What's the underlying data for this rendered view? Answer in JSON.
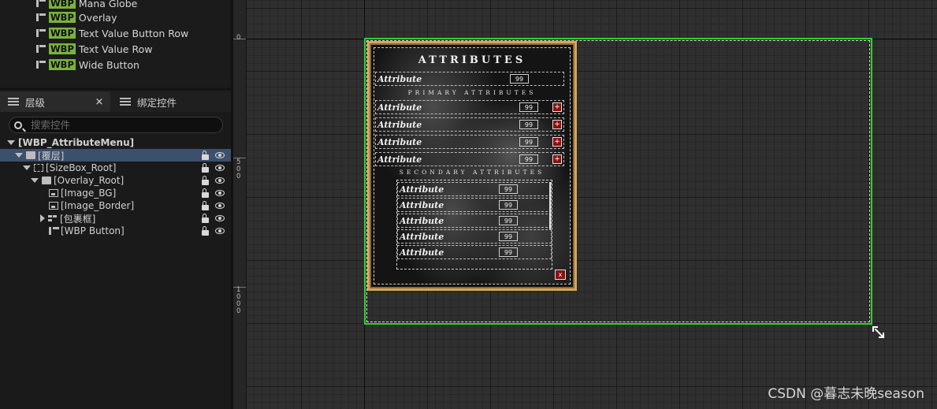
{
  "library": {
    "items": [
      {
        "badge": "WBP",
        "label": "Mana Globe"
      },
      {
        "badge": "WBP",
        "label": "Overlay"
      },
      {
        "badge": "WBP",
        "label": "Text Value Button Row"
      },
      {
        "badge": "WBP",
        "label": "Text Value Row"
      },
      {
        "badge": "WBP",
        "label": "Wide Button"
      }
    ]
  },
  "tabs": {
    "hierarchy": "层级",
    "bind_widgets": "绑定控件",
    "close": "×"
  },
  "search": {
    "placeholder": "搜索控件"
  },
  "tree": {
    "root": "[WBP_AttributeMenu]",
    "nodes": [
      {
        "label": "[覆层]"
      },
      {
        "label": "[SizeBox_Root]"
      },
      {
        "label": "[Overlay_Root]"
      },
      {
        "label": "[Image_BG]"
      },
      {
        "label": "[Image_Border]"
      },
      {
        "label": "[包裹框]"
      },
      {
        "label": "[WBP Button]"
      }
    ]
  },
  "ruler": {
    "ticks": [
      "0",
      "5\n0\n0",
      "1\n0\n0\n0"
    ]
  },
  "widget": {
    "title": "ATTRIBUTES",
    "top_row": {
      "label": "Attribute",
      "value": "99"
    },
    "primary_title": "PRIMARY ATTRIBUTES",
    "primary_rows": [
      {
        "label": "Attribute",
        "value": "99",
        "button": "+"
      },
      {
        "label": "Attribute",
        "value": "99",
        "button": "+"
      },
      {
        "label": "Attribute",
        "value": "99",
        "button": "+"
      },
      {
        "label": "Attribute",
        "value": "99",
        "button": "+"
      }
    ],
    "secondary_title": "SECONDARY ATTRIBUTES",
    "secondary_rows": [
      {
        "label": "Attribute",
        "value": "99"
      },
      {
        "label": "Attribute",
        "value": "99"
      },
      {
        "label": "Attribute",
        "value": "99"
      },
      {
        "label": "Attribute",
        "value": "99"
      },
      {
        "label": "Attribute",
        "value": "99"
      }
    ],
    "close_button": "x"
  },
  "watermark": "CSDN @暮志未晚season",
  "colors": {
    "selection": "#2ed12e",
    "wbp_badge": "#7bb23c",
    "border_gold": "#d9a35a",
    "button_red": "#8c1010",
    "tree_selected": "#3c4f6b"
  }
}
